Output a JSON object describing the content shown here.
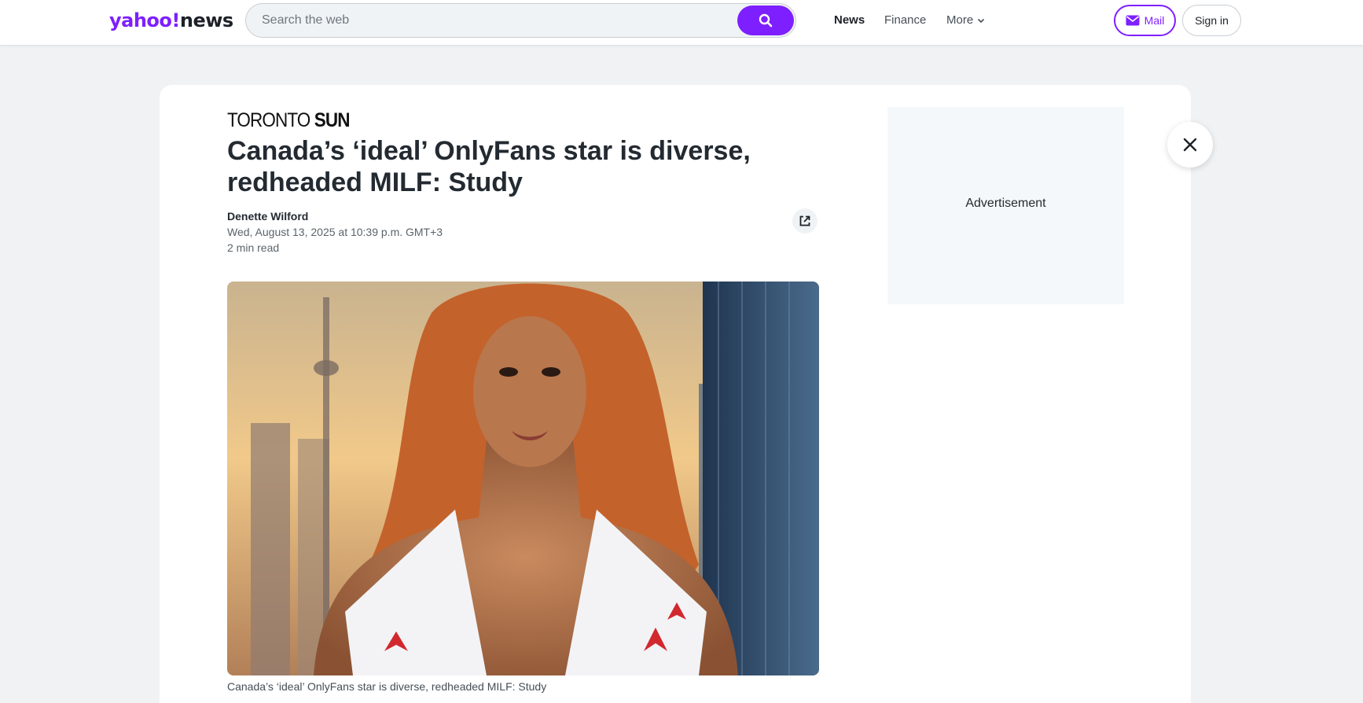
{
  "brand": {
    "logo_part1": "yahoo!",
    "logo_part2": "news",
    "accent_color": "#7e1fff"
  },
  "search": {
    "placeholder": "Search the web",
    "icon": "search-icon"
  },
  "nav": {
    "items": [
      "News",
      "Finance",
      "More"
    ],
    "active": "News"
  },
  "header_buttons": {
    "mail_label": "Mail",
    "mail_icon": "envelope-icon",
    "signin_label": "Sign in"
  },
  "article": {
    "source_part1": "TORONTO",
    "source_part2": "SUN",
    "headline": "Canada’s ‘ideal’ OnlyFans star is diverse, redheaded MILF: Study",
    "author": "Denette Wilford",
    "date": "Wed, August 13, 2025 at 10:39 p.m. GMT+3",
    "read_time": "2 min read",
    "share_icon": "external-link-icon",
    "image_caption": "Canada’s ‘ideal’ OnlyFans star is diverse, redheaded MILF: Study"
  },
  "ad": {
    "label": "Advertisement"
  },
  "overlay": {
    "close_icon": "close-icon"
  }
}
